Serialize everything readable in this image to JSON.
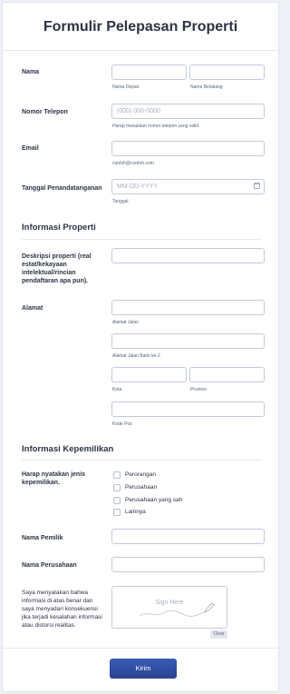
{
  "form": {
    "title": "Formulir Pelepasan Properti"
  },
  "fields": {
    "nama": {
      "label": "Nama",
      "first_sub": "Nama Depan",
      "last_sub": "Nama Belakang"
    },
    "telepon": {
      "label": "Nomor Telepon",
      "placeholder": "(000) 000-0000",
      "sub": "Harap masukkan nomor telepon yang valid."
    },
    "email": {
      "label": "Email",
      "sub": "contoh@contoh.com"
    },
    "tanggal": {
      "label": "Tanggal Penandatanganan",
      "placeholder": "MM-DD-YYYY",
      "sub": "Tanggal"
    }
  },
  "section_properti": {
    "title": "Informasi Properti",
    "deskripsi_label": "Deskripsi properti (real estat/kekayaan intelektual/rincian pendaftaran apa pun).",
    "alamat_label": "Alamat",
    "alamat_jalan": "Alamat Jalan",
    "alamat_jalan2": "Alamat Jalan Baris ke-2",
    "kota": "Kota",
    "provinsi": "Provinsi",
    "kode_pos": "Kode Pos"
  },
  "section_kepemilikan": {
    "title": "Informasi Kepemilikan",
    "jenis_label": "Harap nyatakan jenis kepemilikan.",
    "options": [
      "Perorangan",
      "Perusahaan",
      "Perusahaan yang sah",
      "Lainnya"
    ],
    "nama_pemilik": "Nama Pemilik",
    "nama_perusahaan": "Nama Perusahaan",
    "pernyataan": "Saya menyatakan bahwa informasi di atas benar dan saya menyadari konsekuensi jika terjadi kesalahan informasi atau distorsi realitas."
  },
  "signature": {
    "placeholder": "Sign Here",
    "clear_label": "Clear"
  },
  "actions": {
    "submit_label": "Kirim"
  },
  "icons": {
    "calendar": "calendar-icon",
    "pen": "pen-icon"
  },
  "colors": {
    "accent": "#2f4a9e",
    "border": "#c3cad8"
  }
}
